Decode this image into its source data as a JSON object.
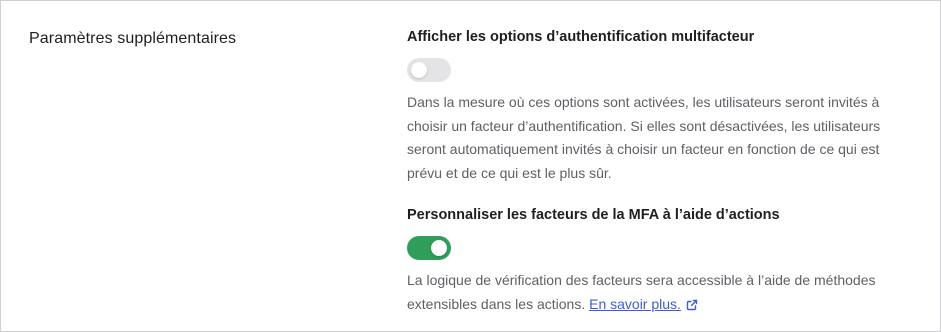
{
  "section": {
    "title": "Paramètres supplémentaires"
  },
  "settings": [
    {
      "label": "Afficher les options d’authentification multifacteur",
      "enabled": false,
      "description": "Dans la mesure où ces options sont activées, les utilisateurs seront invités à choisir un facteur d’authentification. Si elles sont désactivées, les utilisateurs seront automatiquement invités à choisir un facteur en fonction de ce qui est prévu et de ce qui est le plus sûr."
    },
    {
      "label": "Personnaliser les facteurs de la MFA à l’aide d’actions",
      "enabled": true,
      "description": "La logique de vérification des facteurs sera accessible à l’aide de méthodes extensibles dans les actions.",
      "link_text": "En savoir plus.",
      "link_icon": "external-link-icon"
    }
  ],
  "colors": {
    "toggle_on": "#2f9e5b",
    "toggle_off": "#e4e4e7",
    "link": "#3b5bdb"
  }
}
